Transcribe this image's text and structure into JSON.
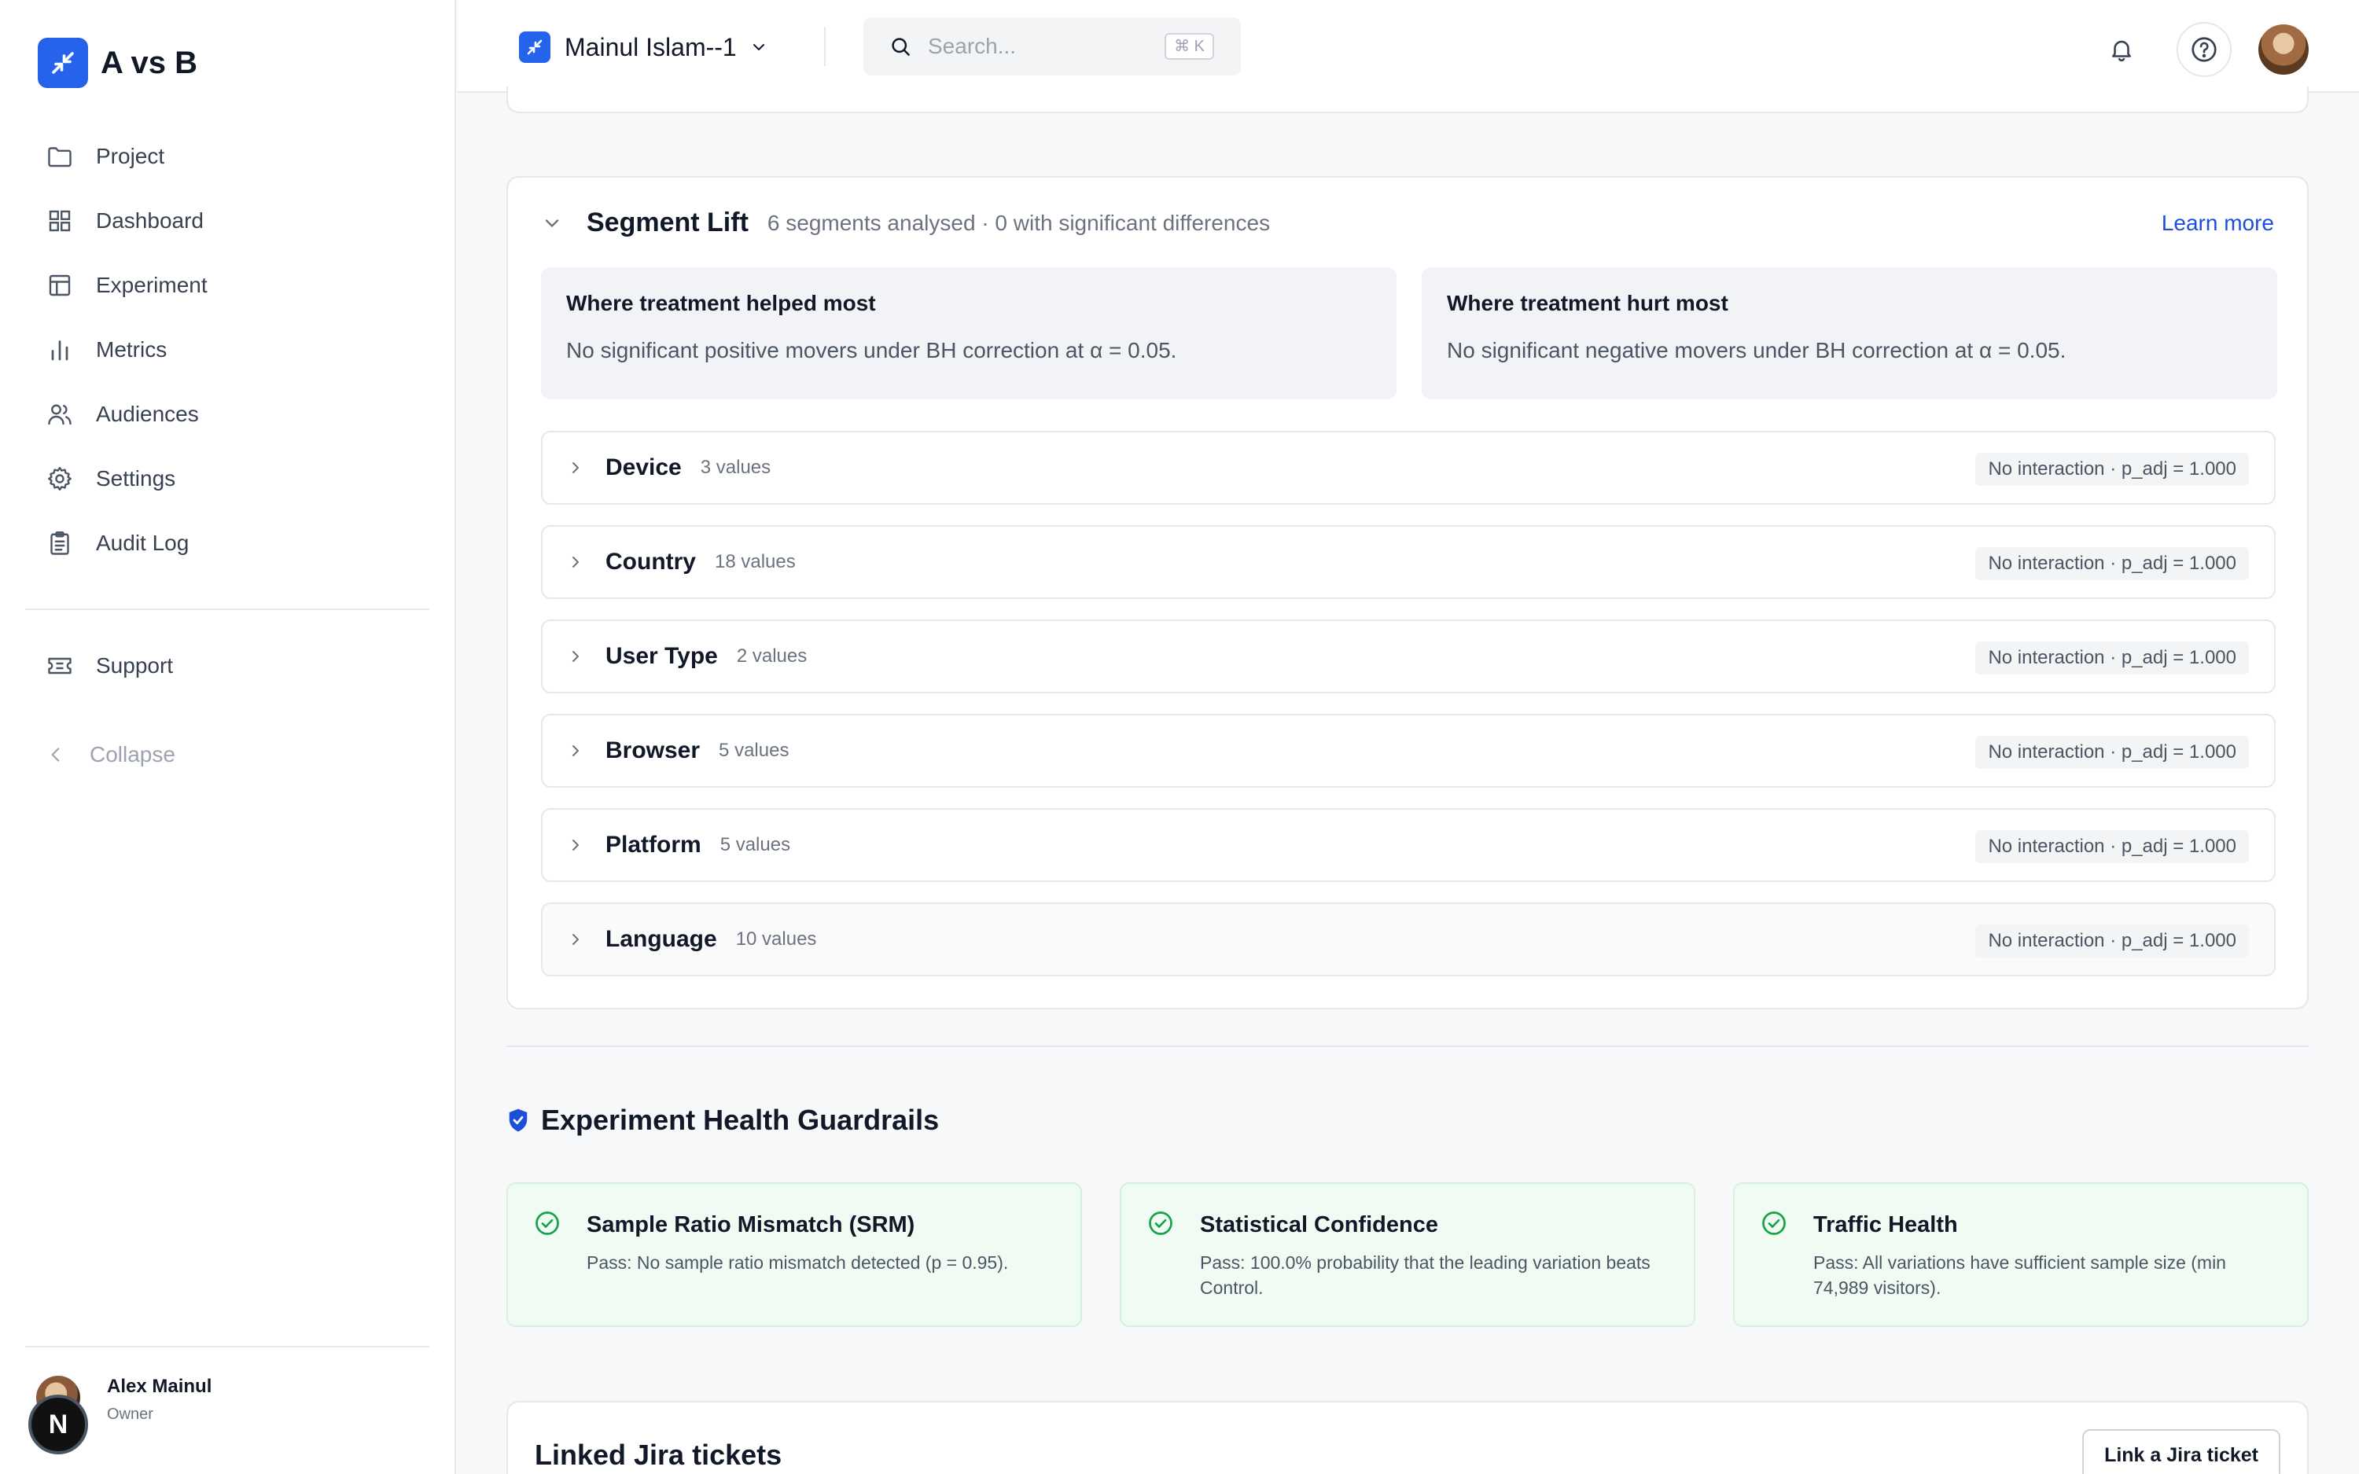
{
  "brand": {
    "name": "A vs B"
  },
  "sidebar": {
    "items": [
      {
        "label": "Project",
        "icon": "folder-icon"
      },
      {
        "label": "Dashboard",
        "icon": "grid-icon"
      },
      {
        "label": "Experiment",
        "icon": "table-icon"
      },
      {
        "label": "Metrics",
        "icon": "bar-chart-icon"
      },
      {
        "label": "Audiences",
        "icon": "users-icon"
      },
      {
        "label": "Settings",
        "icon": "gear-icon"
      },
      {
        "label": "Audit Log",
        "icon": "clipboard-icon"
      }
    ],
    "support_label": "Support",
    "collapse_label": "Collapse"
  },
  "user": {
    "name": "Alex Mainul",
    "role": "Owner",
    "badge": "N"
  },
  "header": {
    "project_name": "Mainul Islam--1",
    "search_placeholder": "Search...",
    "search_shortcut": "⌘ K"
  },
  "segment_lift": {
    "title": "Segment Lift",
    "subtitle": "6 segments analysed · 0 with significant differences",
    "learn_more": "Learn more",
    "helped": {
      "title": "Where treatment helped most",
      "text": "No significant positive movers under BH correction at α = 0.05."
    },
    "hurt": {
      "title": "Where treatment hurt most",
      "text": "No significant negative movers under BH correction at α = 0.05."
    },
    "segments": [
      {
        "name": "Device",
        "count": "3 values",
        "badge": "No interaction · p_adj = 1.000"
      },
      {
        "name": "Country",
        "count": "18 values",
        "badge": "No interaction · p_adj = 1.000"
      },
      {
        "name": "User Type",
        "count": "2 values",
        "badge": "No interaction · p_adj = 1.000"
      },
      {
        "name": "Browser",
        "count": "5 values",
        "badge": "No interaction · p_adj = 1.000"
      },
      {
        "name": "Platform",
        "count": "5 values",
        "badge": "No interaction · p_adj = 1.000"
      },
      {
        "name": "Language",
        "count": "10 values",
        "badge": "No interaction · p_adj = 1.000"
      }
    ]
  },
  "guardrails": {
    "title": "Experiment Health Guardrails",
    "cards": [
      {
        "title": "Sample Ratio Mismatch (SRM)",
        "text": "Pass: No sample ratio mismatch detected (p = 0.95)."
      },
      {
        "title": "Statistical Confidence",
        "text": "Pass: 100.0% probability that the leading variation beats Control."
      },
      {
        "title": "Traffic Health",
        "text": "Pass: All variations have sufficient sample size (min 74,989 visitors)."
      }
    ]
  },
  "jira": {
    "title": "Linked Jira tickets",
    "button": "Link a Jira ticket"
  },
  "colors": {
    "accent": "#2563eb",
    "link": "#1d4ed8",
    "pass_bg": "#f0fbf4",
    "pass_icon": "#16a34a"
  }
}
